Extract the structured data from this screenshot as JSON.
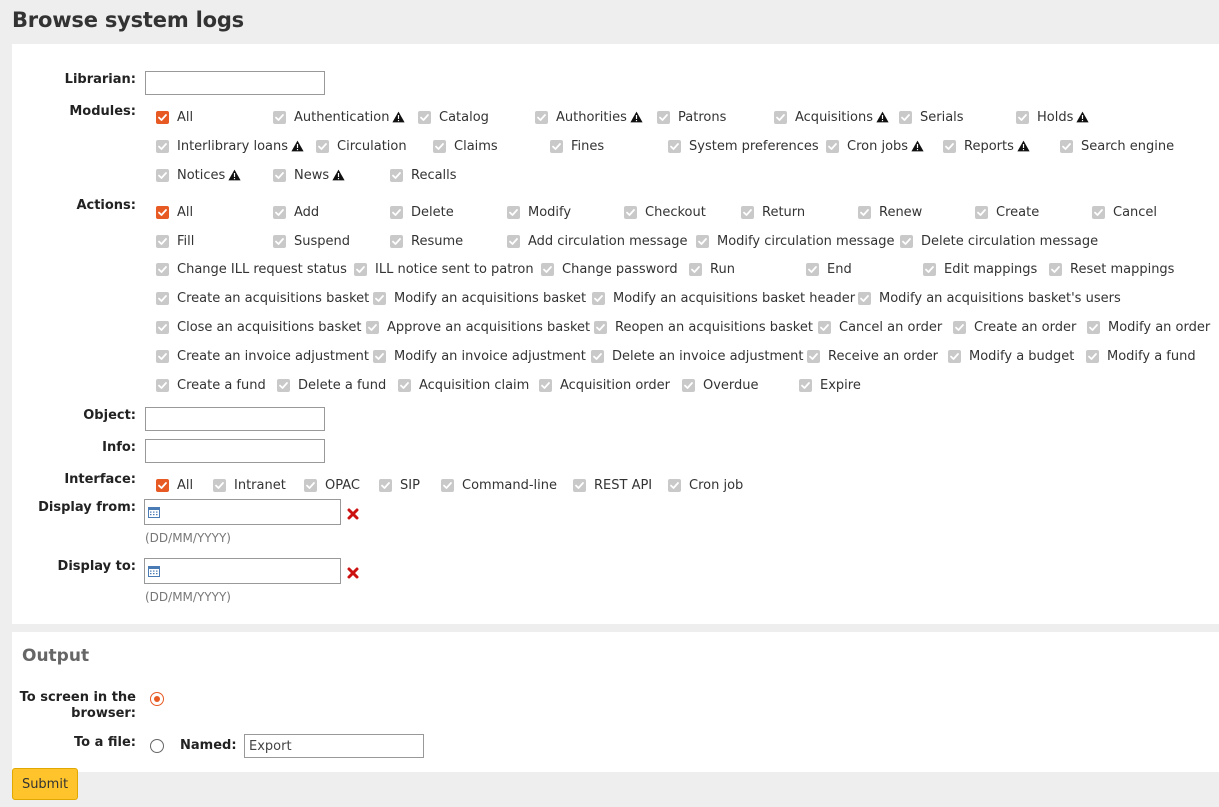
{
  "page_title": "Browse system logs",
  "librarian": {
    "label": "Librarian:",
    "value": ""
  },
  "modules": {
    "label": "Modules:",
    "items": [
      {
        "label": "All",
        "checked": true,
        "warning": false
      },
      {
        "label": "Authentication",
        "checked": false,
        "warning": true
      },
      {
        "label": "Catalog",
        "checked": false,
        "warning": false
      },
      {
        "label": "Authorities",
        "checked": false,
        "warning": true
      },
      {
        "label": "Patrons",
        "checked": false,
        "warning": false
      },
      {
        "label": "Acquisitions",
        "checked": false,
        "warning": true
      },
      {
        "label": "Serials",
        "checked": false,
        "warning": false
      },
      {
        "label": "Holds",
        "checked": false,
        "warning": true
      },
      {
        "label": "Interlibrary loans",
        "checked": false,
        "warning": true
      },
      {
        "label": "Circulation",
        "checked": false,
        "warning": false
      },
      {
        "label": "Claims",
        "checked": false,
        "warning": false
      },
      {
        "label": "Fines",
        "checked": false,
        "warning": false
      },
      {
        "label": "System preferences",
        "checked": false,
        "warning": false
      },
      {
        "label": "Cron jobs",
        "checked": false,
        "warning": true
      },
      {
        "label": "Reports",
        "checked": false,
        "warning": true
      },
      {
        "label": "Search engine",
        "checked": false,
        "warning": false
      },
      {
        "label": "Notices",
        "checked": false,
        "warning": true
      },
      {
        "label": "News",
        "checked": false,
        "warning": true
      },
      {
        "label": "Recalls",
        "checked": false,
        "warning": false
      }
    ]
  },
  "actions": {
    "label": "Actions:",
    "items": [
      {
        "label": "All",
        "checked": true
      },
      {
        "label": "Add",
        "checked": false
      },
      {
        "label": "Delete",
        "checked": false
      },
      {
        "label": "Modify",
        "checked": false
      },
      {
        "label": "Checkout",
        "checked": false
      },
      {
        "label": "Return",
        "checked": false
      },
      {
        "label": "Renew",
        "checked": false
      },
      {
        "label": "Create",
        "checked": false
      },
      {
        "label": "Cancel",
        "checked": false
      },
      {
        "label": "Fill",
        "checked": false
      },
      {
        "label": "Suspend",
        "checked": false
      },
      {
        "label": "Resume",
        "checked": false
      },
      {
        "label": "Add circulation message",
        "checked": false
      },
      {
        "label": "Modify circulation message",
        "checked": false
      },
      {
        "label": "Delete circulation message",
        "checked": false
      },
      {
        "label": "Change ILL request status",
        "checked": false
      },
      {
        "label": "ILL notice sent to patron",
        "checked": false
      },
      {
        "label": "Change password",
        "checked": false
      },
      {
        "label": "Run",
        "checked": false
      },
      {
        "label": "End",
        "checked": false
      },
      {
        "label": "Edit mappings",
        "checked": false
      },
      {
        "label": "Reset mappings",
        "checked": false
      },
      {
        "label": "Create an acquisitions basket",
        "checked": false
      },
      {
        "label": "Modify an acquisitions basket",
        "checked": false
      },
      {
        "label": "Modify an acquisitions basket header",
        "checked": false
      },
      {
        "label": "Modify an acquisitions basket's users",
        "checked": false
      },
      {
        "label": "Close an acquisitions basket",
        "checked": false
      },
      {
        "label": "Approve an acquisitions basket",
        "checked": false
      },
      {
        "label": "Reopen an acquisitions basket",
        "checked": false
      },
      {
        "label": "Cancel an order",
        "checked": false
      },
      {
        "label": "Create an order",
        "checked": false
      },
      {
        "label": "Modify an order",
        "checked": false
      },
      {
        "label": "Create an invoice adjustment",
        "checked": false
      },
      {
        "label": "Modify an invoice adjustment",
        "checked": false
      },
      {
        "label": "Delete an invoice adjustment",
        "checked": false
      },
      {
        "label": "Receive an order",
        "checked": false
      },
      {
        "label": "Modify a budget",
        "checked": false
      },
      {
        "label": "Modify a fund",
        "checked": false
      },
      {
        "label": "Create a fund",
        "checked": false
      },
      {
        "label": "Delete a fund",
        "checked": false
      },
      {
        "label": "Acquisition claim",
        "checked": false
      },
      {
        "label": "Acquisition order",
        "checked": false
      },
      {
        "label": "Overdue",
        "checked": false
      },
      {
        "label": "Expire",
        "checked": false
      }
    ]
  },
  "object": {
    "label": "Object:",
    "value": ""
  },
  "info": {
    "label": "Info:",
    "value": ""
  },
  "interface": {
    "label": "Interface:",
    "items": [
      {
        "label": "All",
        "checked": true
      },
      {
        "label": "Intranet",
        "checked": false
      },
      {
        "label": "OPAC",
        "checked": false
      },
      {
        "label": "SIP",
        "checked": false
      },
      {
        "label": "Command-line",
        "checked": false
      },
      {
        "label": "REST API",
        "checked": false
      },
      {
        "label": "Cron job",
        "checked": false
      }
    ]
  },
  "display_from": {
    "label": "Display from:",
    "value": "",
    "format_hint": "(DD/MM/YYYY)"
  },
  "display_to": {
    "label": "Display to:",
    "value": "",
    "format_hint": "(DD/MM/YYYY)"
  },
  "output": {
    "title": "Output",
    "to_screen_label": "To screen in the browser:",
    "to_screen_selected": true,
    "to_file_label": "To a file:",
    "to_file_selected": false,
    "named_label": "Named:",
    "filename": "Export"
  },
  "submit_label": "Submit",
  "colors": {
    "accent": "#e75a23",
    "submit": "#ffc32b",
    "background": "#eeeeee",
    "unchecked_box": "#c9c9c9"
  },
  "icons": {
    "warning": "warning-triangle-icon",
    "calendar": "calendar-icon",
    "clear": "clear-x-icon"
  }
}
